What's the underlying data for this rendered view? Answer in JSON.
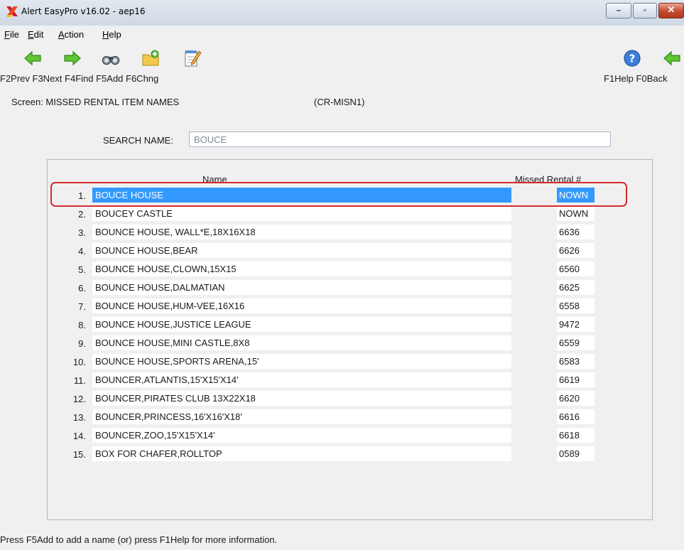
{
  "window": {
    "title": "Alert EasyPro v16.02 - aep16",
    "min_glyph": "–",
    "max_glyph": "▫",
    "close_glyph": "✕"
  },
  "menu": {
    "file": {
      "u": "F",
      "rest": "ile"
    },
    "edit": {
      "u": "E",
      "rest": "dit"
    },
    "action": {
      "u": "A",
      "rest": "ction"
    },
    "help": {
      "u": "H",
      "rest": "elp"
    }
  },
  "toolbar": {
    "icons": [
      "prev-arrow-icon",
      "next-arrow-icon",
      "binoculars-icon",
      "add-folder-icon",
      "change-notepad-icon",
      "help-icon",
      "back-arrow-icon"
    ],
    "shortcuts_left": "F2Prev F3Next F4Find F5Add F6Chng",
    "shortcuts_right": "F1Help F0Back"
  },
  "screen": {
    "label": "Screen: MISSED RENTAL ITEM NAMES",
    "code": "(CR-MISN1)"
  },
  "search": {
    "label": "SEARCH NAME:",
    "value": "BOUCE"
  },
  "list": {
    "headers": {
      "name": "Name",
      "number": "Missed Rental #"
    },
    "rows": [
      {
        "idx": "1.",
        "name": "BOUCE HOUSE",
        "num": "NOWN",
        "selected": true
      },
      {
        "idx": "2.",
        "name": "BOUCEY CASTLE",
        "num": "NOWN"
      },
      {
        "idx": "3.",
        "name": "BOUNCE HOUSE, WALL*E,18X16X18",
        "num": "6636"
      },
      {
        "idx": "4.",
        "name": "BOUNCE HOUSE,BEAR",
        "num": "6626"
      },
      {
        "idx": "5.",
        "name": "BOUNCE HOUSE,CLOWN,15X15",
        "num": "6560"
      },
      {
        "idx": "6.",
        "name": "BOUNCE HOUSE,DALMATIAN",
        "num": "6625"
      },
      {
        "idx": "7.",
        "name": "BOUNCE HOUSE,HUM-VEE,16X16",
        "num": "6558"
      },
      {
        "idx": "8.",
        "name": "BOUNCE HOUSE,JUSTICE LEAGUE",
        "num": "9472"
      },
      {
        "idx": "9.",
        "name": "BOUNCE HOUSE,MINI CASTLE,8X8",
        "num": "6559"
      },
      {
        "idx": "10.",
        "name": "BOUNCE HOUSE,SPORTS ARENA,15'",
        "num": "6583"
      },
      {
        "idx": "11.",
        "name": "BOUNCER,ATLANTIS,15'X15'X14'",
        "num": "6619"
      },
      {
        "idx": "12.",
        "name": "BOUNCER,PIRATES CLUB 13X22X18",
        "num": "6620"
      },
      {
        "idx": "13.",
        "name": "BOUNCER,PRINCESS,16'X16'X18'",
        "num": "6616"
      },
      {
        "idx": "14.",
        "name": "BOUNCER,ZOO,15'X15'X14'",
        "num": "6618"
      },
      {
        "idx": "15.",
        "name": "BOX FOR CHAFER,ROLLTOP",
        "num": "0589"
      }
    ]
  },
  "status": "Press F5Add to add a name (or) press F1Help for more information.",
  "colors": {
    "selection": "#3399ff",
    "highlight_border": "#d62b2b",
    "background": "#f0f0f0"
  }
}
